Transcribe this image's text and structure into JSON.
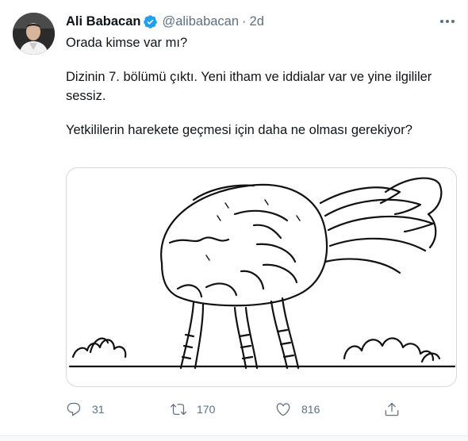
{
  "tweet": {
    "author_name": "Ali Babacan",
    "author_handle": "@alibabacan",
    "separator": "·",
    "time": "2d",
    "paragraphs": [
      "Orada kimse var mı?",
      "Dizinin 7. bölümü çıktı. Yeni itham ve iddialar var ve yine ilgililer sessiz.",
      "Yetkililerin harekete geçmesi için daha ne olması gerekiyor?"
    ],
    "media_icon": "ostrich-head-in-sand-illustration",
    "stats": {
      "replies": "31",
      "retweets": "170",
      "likes": "816"
    }
  },
  "icons": {
    "verified": "verified-badge-icon",
    "more": "more-options-icon",
    "reply": "reply-icon",
    "retweet": "retweet-icon",
    "like": "heart-icon",
    "share": "share-icon"
  },
  "colors": {
    "verified_blue": "#1da1f2",
    "secondary_text": "#5b7083",
    "border": "#cfd9de"
  }
}
